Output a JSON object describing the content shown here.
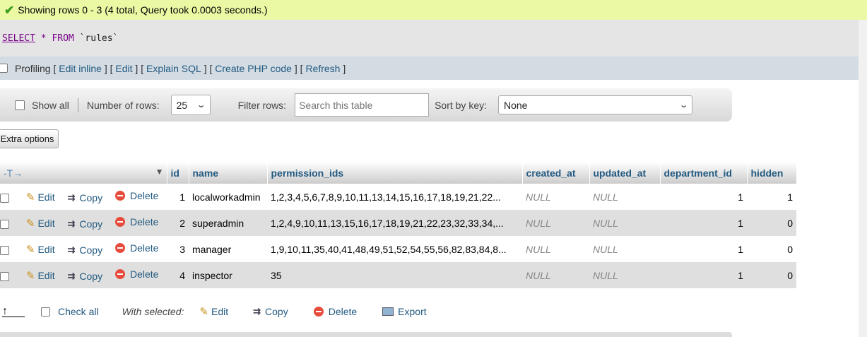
{
  "success": {
    "message": "Showing rows 0 - 3 (4 total, Query took 0.0003 seconds.)"
  },
  "sql": {
    "select": "SELECT",
    "star": "*",
    "from": "FROM",
    "table": "`rules`"
  },
  "links": {
    "profiling": "Profiling",
    "edit_inline": "Edit inline",
    "edit": "Edit",
    "explain": "Explain SQL",
    "php": "Create PHP code",
    "refresh": "Refresh"
  },
  "nav": {
    "show_all": "Show all",
    "rows_label": "Number of rows:",
    "rows_value": "25",
    "filter_label": "Filter rows:",
    "filter_placeholder": "Search this table",
    "sort_label": "Sort by key:",
    "sort_value": "None"
  },
  "extra_options": "Extra options",
  "table": {
    "headers": [
      "id",
      "name",
      "permission_ids",
      "created_at",
      "updated_at",
      "department_id",
      "hidden"
    ],
    "actions": {
      "edit": "Edit",
      "copy": "Copy",
      "delete": "Delete"
    },
    "rows": [
      {
        "id": "1",
        "name": "localworkadmin",
        "permission_ids": "1,2,3,4,5,6,7,8,9,10,11,13,14,15,16,17,18,19,21,22...",
        "created_at": "NULL",
        "updated_at": "NULL",
        "department_id": "1",
        "hidden": "1"
      },
      {
        "id": "2",
        "name": "superadmin",
        "permission_ids": "1,2,4,9,10,11,13,15,16,17,18,19,21,22,23,32,33,34,...",
        "created_at": "NULL",
        "updated_at": "NULL",
        "department_id": "1",
        "hidden": "0"
      },
      {
        "id": "3",
        "name": "manager",
        "permission_ids": "1,9,10,11,35,40,41,48,49,51,52,54,55,56,82,83,84,8...",
        "created_at": "NULL",
        "updated_at": "NULL",
        "department_id": "1",
        "hidden": "0"
      },
      {
        "id": "4",
        "name": "inspector",
        "permission_ids": "35",
        "created_at": "NULL",
        "updated_at": "NULL",
        "department_id": "1",
        "hidden": "0"
      }
    ]
  },
  "footer": {
    "check_all": "Check all",
    "with_selected": "With selected:",
    "edit": "Edit",
    "copy": "Copy",
    "delete": "Delete",
    "export": "Export"
  },
  "colors": {
    "success_bg": "#ebf8a4",
    "link": "#235a81",
    "row_alt": "#dfdfdf"
  }
}
